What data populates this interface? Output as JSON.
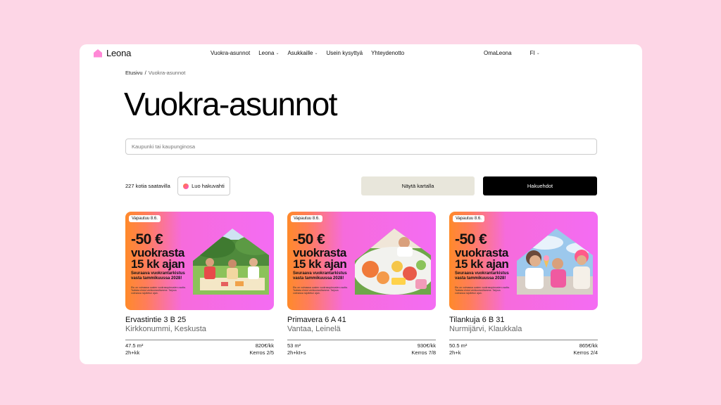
{
  "header": {
    "logo_text": "Leona",
    "brand_color": "#ff88d6",
    "nav": [
      {
        "label": "Vuokra-asunnot",
        "dropdown": false
      },
      {
        "label": "Leona",
        "dropdown": true
      },
      {
        "label": "Asukkaille",
        "dropdown": true
      },
      {
        "label": "Usein kysyttyä",
        "dropdown": false
      },
      {
        "label": "Yhteydenotto",
        "dropdown": false
      }
    ],
    "account_label": "OmaLeona",
    "language_label": "FI"
  },
  "breadcrumb": {
    "home": "Etusivu",
    "separator": "/",
    "current": "Vuokra-asunnot"
  },
  "page_title": "Vuokra-asunnot",
  "search": {
    "placeholder": "Kaupunki tai kaupunginosa",
    "value": ""
  },
  "toolbar": {
    "count_label": "227 kotia saatavilla",
    "watch_label": "Luo hakuvahti",
    "map_label": "Näytä kartalla",
    "filter_label": "Hakuehdot"
  },
  "promo": {
    "line1": "-50 €",
    "line2": "vuokrasta",
    "line3": "15 kk ajan",
    "sub": "Seuraava vuokrantarkistus vasta tammikuussa 2028!",
    "fine": "Etu on voimassa uusien vuokrasopimusten osalta. Tarkista ehdot verkkosivuiltamme. Tarjous voimassa rajoitetun ajan."
  },
  "listings": [
    {
      "badge": "Vapautuu 8.6.",
      "title": "Ervastintie 3 B 25",
      "location": "Kirkkonummi, Keskusta",
      "area": "47.5 m²",
      "rooms": "2h+kk",
      "price": "820€/kk",
      "floor": "Kerros 2/5",
      "photo": "picnic-family-icon"
    },
    {
      "badge": "Vapautuu 8.6.",
      "title": "Primavera 6 A 41",
      "location": "Vantaa, Leinelä",
      "area": "53 m²",
      "rooms": "2h+kt+s",
      "price": "930€/kk",
      "floor": "Kerros 7/8",
      "photo": "fruit-picnic-icon"
    },
    {
      "badge": "Vapautuu 8.6.",
      "title": "Tilankuja 6 B 31",
      "location": "Nurmijärvi, Klaukkala",
      "area": "50.5 m²",
      "rooms": "2h+k",
      "price": "865€/kk",
      "floor": "Kerros 2/4",
      "photo": "children-icecream-icon"
    }
  ]
}
